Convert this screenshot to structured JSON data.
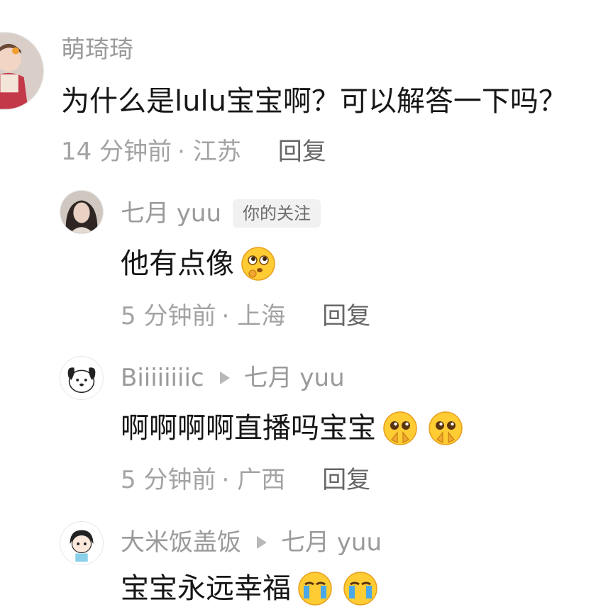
{
  "comments": [
    {
      "author": "萌琦琦",
      "text": "为什么是lulu宝宝啊？可以解答一下吗？",
      "time": "14 分钟前",
      "location": "· 江苏",
      "reply_label": "回复",
      "avatar_icon": "child-photo-avatar"
    },
    {
      "author": "七月 yuu",
      "badge": "你的关注",
      "text": "他有点像",
      "emoji": "thinking-face-emoji",
      "time": "5 分钟前",
      "location": "· 上海",
      "reply_label": "回复",
      "avatar_icon": "woman-photo-avatar"
    },
    {
      "author": "Biiiiiiiic",
      "reply_to": "七月 yuu",
      "text": "啊啊啊啊直播吗宝宝",
      "emoji": "pleading-face-emoji",
      "time": "5 分钟前",
      "location": "· 广西",
      "reply_label": "回复",
      "avatar_icon": "cartoon-dog-avatar"
    },
    {
      "author": "大米饭盖饭",
      "reply_to": "七月 yuu",
      "text": "宝宝永远幸福",
      "emoji": "crying-face-emoji",
      "avatar_icon": "cartoon-girl-avatar"
    }
  ],
  "colors": {
    "name": "#9a9a9a",
    "text": "#161616",
    "meta": "#a3a3a3",
    "reply": "#666666",
    "emoji_yellow": "#ffcc33"
  }
}
